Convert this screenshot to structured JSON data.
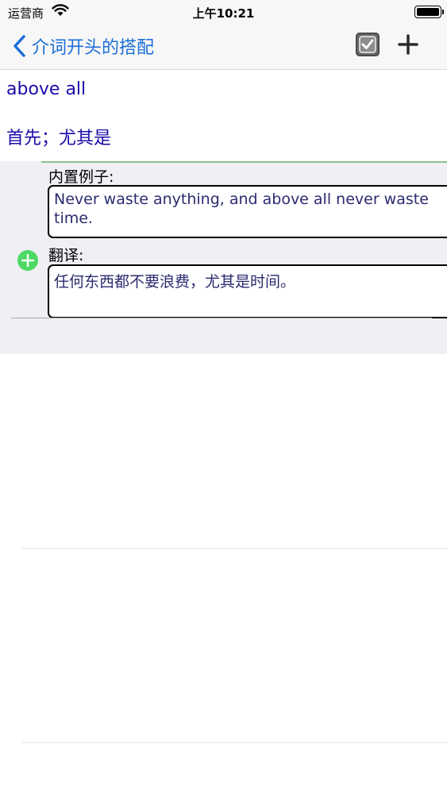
{
  "status_bar": {
    "carrier": "运营商",
    "time": "上午10:21",
    "icons": [
      "wifi-icon",
      "battery-icon"
    ]
  },
  "nav": {
    "back_label": "介词开头的搭配",
    "icons": [
      "chevron-left-icon",
      "checkbox-checked-icon",
      "plus-icon"
    ],
    "accent_color": "#1a6fd9"
  },
  "entry": {
    "phrase": "above all",
    "meaning": "首先；尤其是",
    "text_color": "#1a0ca8"
  },
  "example": {
    "label": "内置例子:",
    "sentence": "Never waste anything, and above all never waste time.",
    "translation_label": "翻译:",
    "translation": "任何东西都不要浪费，尤其是时间。",
    "add_icon_color": "#4cd964"
  }
}
